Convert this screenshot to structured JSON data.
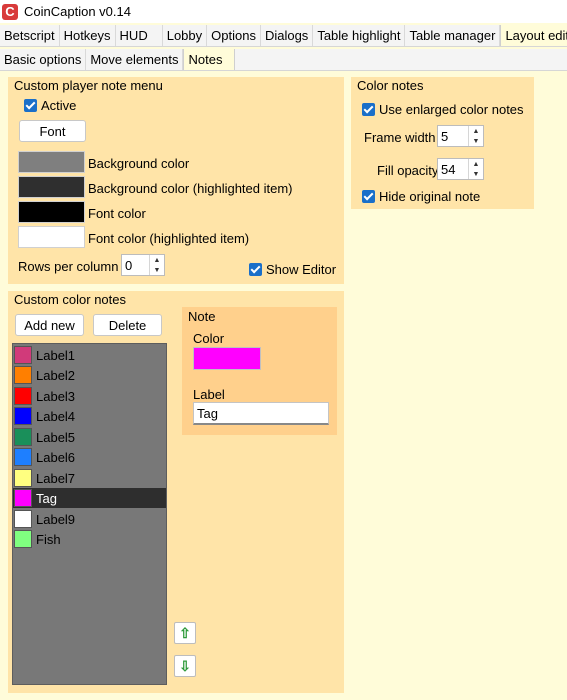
{
  "window": {
    "title": "CoinCaption v0.14",
    "icon_letter": "C"
  },
  "tabs_top": [
    "Betscript",
    "Hotkeys",
    "HUD",
    "Lobby",
    "Options",
    "Dialogs",
    "Table highlight",
    "Table manager",
    "Layout editor"
  ],
  "tabs_sub": [
    "Basic options",
    "Move elements",
    "Notes"
  ],
  "custom_menu": {
    "title": "Custom player note menu",
    "active_label": "Active",
    "font_button": "Font",
    "colors": [
      {
        "label": "Background color",
        "color": "#7f7f7f"
      },
      {
        "label": "Background color (highlighted item)",
        "color": "#2f2f2f"
      },
      {
        "label": "Font color",
        "color": "#000000"
      },
      {
        "label": "Font color (highlighted item)",
        "color": "#ffffff"
      }
    ],
    "rows_label": "Rows per column",
    "rows_value": "0",
    "show_editor_label": "Show Editor"
  },
  "color_notes": {
    "title": "Color notes",
    "use_enlarged_label": "Use enlarged color notes",
    "frame_width_label": "Frame width",
    "frame_width_value": "5",
    "fill_opacity_label": "Fill opacity",
    "fill_opacity_value": "54",
    "hide_original_label": "Hide original note"
  },
  "custom_color_notes": {
    "title": "Custom color notes",
    "add_button": "Add new",
    "delete_button": "Delete",
    "items": [
      {
        "label": "Label1",
        "color": "#d13a7a"
      },
      {
        "label": "Label2",
        "color": "#ff7f00"
      },
      {
        "label": "Label3",
        "color": "#ff0000"
      },
      {
        "label": "Label4",
        "color": "#0000ff"
      },
      {
        "label": "Label5",
        "color": "#1a8f5a"
      },
      {
        "label": "Label6",
        "color": "#1e7fff"
      },
      {
        "label": "Label7",
        "color": "#ffff80"
      },
      {
        "label": "Tag",
        "color": "#ff00ff",
        "selected": true
      },
      {
        "label": "Label9",
        "color": "#ffffff"
      },
      {
        "label": "Fish",
        "color": "#80ff80"
      }
    ]
  },
  "note_panel": {
    "title": "Note",
    "color_label": "Color",
    "color_value": "#ff00ff",
    "label_label": "Label",
    "label_value": "Tag"
  },
  "move_buttons": {
    "up": "⇧",
    "down": "⇩"
  }
}
